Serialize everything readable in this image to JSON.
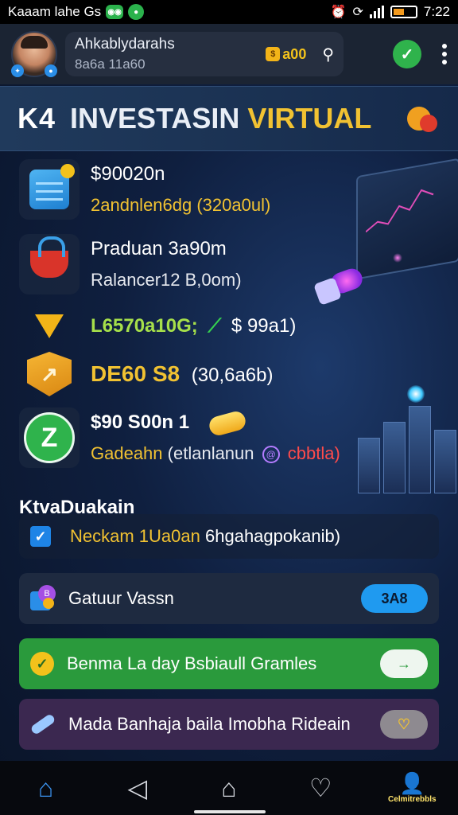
{
  "status_bar": {
    "left_text": "Kaaam lahe Gs",
    "time": "7:22"
  },
  "header": {
    "user_name": "Ahkablydarahs",
    "user_id": "8a6a 11a60",
    "coin_amount": "a00"
  },
  "title_bar": {
    "prefix": "K4",
    "main": "INVESTASIN",
    "accent": "VIRTUAL"
  },
  "entries": [
    {
      "line1": "$90020n",
      "line2": "2andnlen6dg (320a0ul)",
      "line2_color": "#f1c232"
    },
    {
      "line1": "Praduan 3a90m",
      "line2": "Ralancer12 B,0om)",
      "line2_color": "#e6e9ef"
    },
    {
      "line1_a": "L6570a10G;",
      "line1_b": "$ 99a1)",
      "line1_a_color": "#a6e04a"
    },
    {
      "line1_a": "DE60 S8",
      "line1_b": "(30,6a6b)",
      "line1_a_color": "#f1c232"
    },
    {
      "line1": "$90 S00n 1",
      "line2_a": "Gadeahn",
      "line2_b": "(etlanlanun",
      "line2_c": "cbbtla)",
      "line2_color": "#f1c232"
    }
  ],
  "section": {
    "title": "KtvaDuakain",
    "check_label_a": "Neckam 1Ua0an",
    "check_label_b": "6hgahagpokanib)"
  },
  "cards": [
    {
      "label": "Gatuur Vassn",
      "button": "3A8",
      "bg": "#1e2a40",
      "button_bg": "#1f9af0"
    },
    {
      "label": "Benma La day Bsbiaull Gramles",
      "button": "→",
      "bg": "#2a9a3c",
      "button_bg": "#eef6ef"
    },
    {
      "label": "Mada Banhaja baila Imobha Rideain",
      "button": "♡",
      "bg": "#3b2850",
      "button_bg": "#8e8a90"
    }
  ],
  "navbar": {
    "items": [
      "home",
      "back",
      "launcher",
      "favorites",
      "profile"
    ],
    "profile_label": "Celmitrebbls"
  },
  "colors": {
    "accent_yellow": "#f1c232",
    "accent_green": "#2fb34c",
    "accent_blue": "#1f9af0"
  }
}
